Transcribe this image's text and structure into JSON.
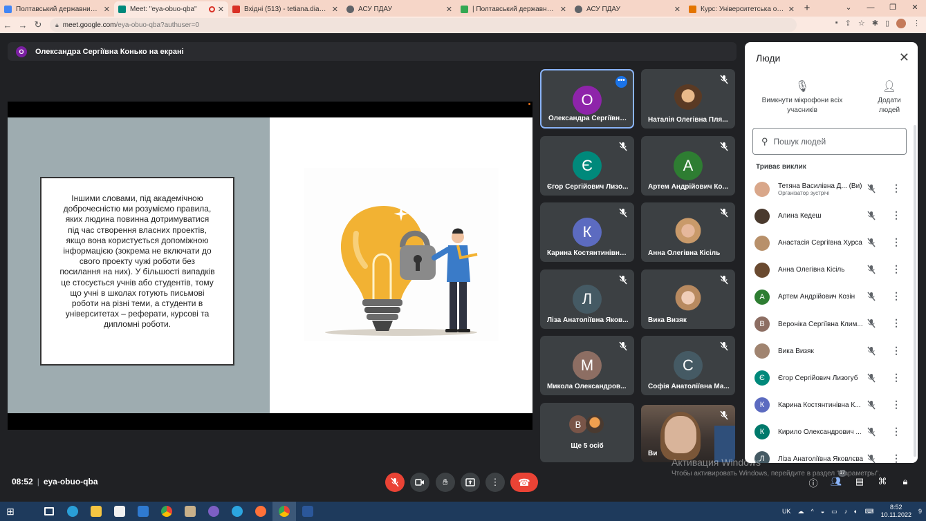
{
  "browser": {
    "tabs": [
      {
        "title": "Полтавський державний аграр",
        "color": "#4285f4"
      },
      {
        "title": "Meet: \"eya-obuo-qba\"",
        "color": "#00897b",
        "active": true,
        "recording": true
      },
      {
        "title": "Вхідні (513) - tetiana.diadyk@p",
        "color": "#d93025"
      },
      {
        "title": "АСУ ПДАУ",
        "color": "#5f6368"
      },
      {
        "title": "| Полтавський державний агра",
        "color": "#34a853"
      },
      {
        "title": "АСУ ПДАУ",
        "color": "#5f6368"
      },
      {
        "title": "Курс: Університетська освіта_",
        "color": "#e37400"
      }
    ],
    "url_host": "meet.google.com",
    "url_path": "/eya-obuo-qba?authuser=0"
  },
  "meeting": {
    "presenter_initial": "О",
    "presenter_text": "Олександра Сергіївна Конько на екрані",
    "time": "08:52",
    "code": "eya-obuo-qba",
    "participant_count": "17"
  },
  "slide": {
    "text": "Іншими словами, під академічною доброчесністю ми розуміємо правила, яких людина повинна дотримуватися під час створення власних проектів, якщо вона користується допоміжною інформацією (зокрема не включати до свого проекту чужі роботи без посилання на них). У більшості випадків це стосується учнів або студентів, тому що учні в школах готують письмові роботи на різні теми, а студенти в університетах – реферати, курсові та дипломні роботи."
  },
  "tiles": [
    {
      "name": "Олександра Сергіївна...",
      "initial": "О",
      "color": "#8e24aa"
    },
    {
      "name": "Наталія Олегівна Пля...",
      "initial": "",
      "color": "#3c4043"
    },
    {
      "name": "Єгор Сергійович Лизо...",
      "initial": "Є",
      "color": "#00897b"
    },
    {
      "name": "Артем Андрійович Ко...",
      "initial": "А",
      "color": "#2e7d32"
    },
    {
      "name": "Карина Костянтинівна...",
      "initial": "К",
      "color": "#5c6bc0"
    },
    {
      "name": "Анна Олегівна Кісіль",
      "initial": "",
      "color": "#3c4043"
    },
    {
      "name": "Ліза Анатоліївна Яков...",
      "initial": "Л",
      "color": "#455a64"
    },
    {
      "name": "Вика Визяк",
      "initial": "",
      "color": "#3c4043"
    },
    {
      "name": "Микола Олександров...",
      "initial": "М",
      "color": "#8d6e63"
    },
    {
      "name": "Софія Анатоліївна Ма...",
      "initial": "С",
      "color": "#455a64"
    },
    {
      "name": "Ще 5 осіб",
      "initial": "В",
      "color": "#795548"
    },
    {
      "name": "Ви",
      "initial": "",
      "color": "#3c4043"
    }
  ],
  "people_panel": {
    "title": "Люди",
    "mute_all": "Вимкнути мікрофони всіх учасників",
    "add_people": "Додати людей",
    "search_placeholder": "Пошук людей",
    "section": "Триває виклик",
    "people": [
      {
        "name": "Тетяна Василівна Д...  (Ви)",
        "sub": "Організатор зустрічі",
        "initial": "",
        "color": "#d9a78a"
      },
      {
        "name": "Алина Кедеш",
        "initial": "",
        "color": "#4a3a2e"
      },
      {
        "name": "Анастасія Сергіївна Хурса",
        "initial": "",
        "color": "#b8906a"
      },
      {
        "name": "Анна Олегівна Кісіль",
        "initial": "",
        "color": "#6a4a30"
      },
      {
        "name": "Артем Андрійович Козін",
        "initial": "А",
        "color": "#2e7d32"
      },
      {
        "name": "Вероніка Сергіївна Клим...",
        "initial": "В",
        "color": "#8d6e63"
      },
      {
        "name": "Вика Визяк",
        "initial": "",
        "color": "#a08470"
      },
      {
        "name": "Єгор Сергійович Лизогуб",
        "initial": "Є",
        "color": "#00897b"
      },
      {
        "name": "Карина Костянтинівна К...",
        "initial": "К",
        "color": "#5c6bc0"
      },
      {
        "name": "Кирило Олександрович ...",
        "initial": "К",
        "color": "#00796b"
      },
      {
        "name": "Ліза Анатоліївна Яковлєва",
        "initial": "Л",
        "color": "#455a64"
      }
    ]
  },
  "windows": {
    "watermark_title": "Активация Windows",
    "watermark_text": "Чтобы активировать Windows, перейдите в раздел \"Параметры\".",
    "lang": "UK",
    "clock_time": "8:52",
    "clock_date": "10.11.2022",
    "notifications": "9"
  }
}
